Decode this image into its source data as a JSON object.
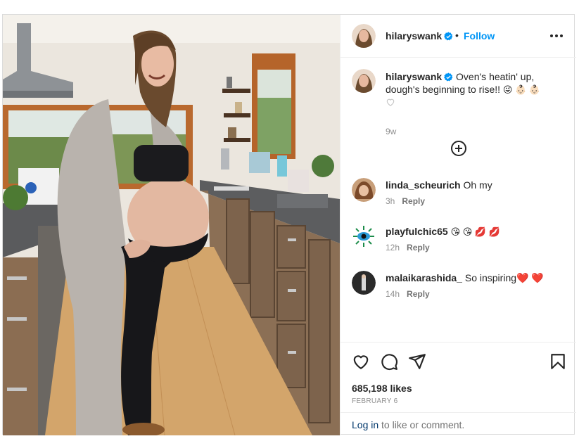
{
  "post": {
    "username": "hilaryswank",
    "dot": "•",
    "follow_label": "Follow",
    "more_icon": "more-horizontal-icon",
    "caption_text": "Oven's heatin' up, dough's beginning to rise!!",
    "caption_emojis": "😜 👶🏻 👶🏻",
    "caption_age": "9w",
    "load_more_icon": "plus-circle-icon",
    "comments": [
      {
        "user": "linda_scheurich",
        "text": "Oh my",
        "age": "3h",
        "reply": "Reply"
      },
      {
        "user": "playfulchic65",
        "text": "😘 😘 💋 💋",
        "age": "12h",
        "reply": "Reply"
      },
      {
        "user": "malaikarashida_",
        "text": "So inspiring❤️ ❤️",
        "age": "14h",
        "reply": "Reply"
      }
    ],
    "likes": "685,198 likes",
    "date": "FEBRUARY 6",
    "login_link": "Log in",
    "login_rest": " to like or comment.",
    "colors": {
      "link_blue": "#0095f6",
      "verified": "#0095f6",
      "text": "#262626",
      "muted": "#8e8e8e"
    }
  }
}
